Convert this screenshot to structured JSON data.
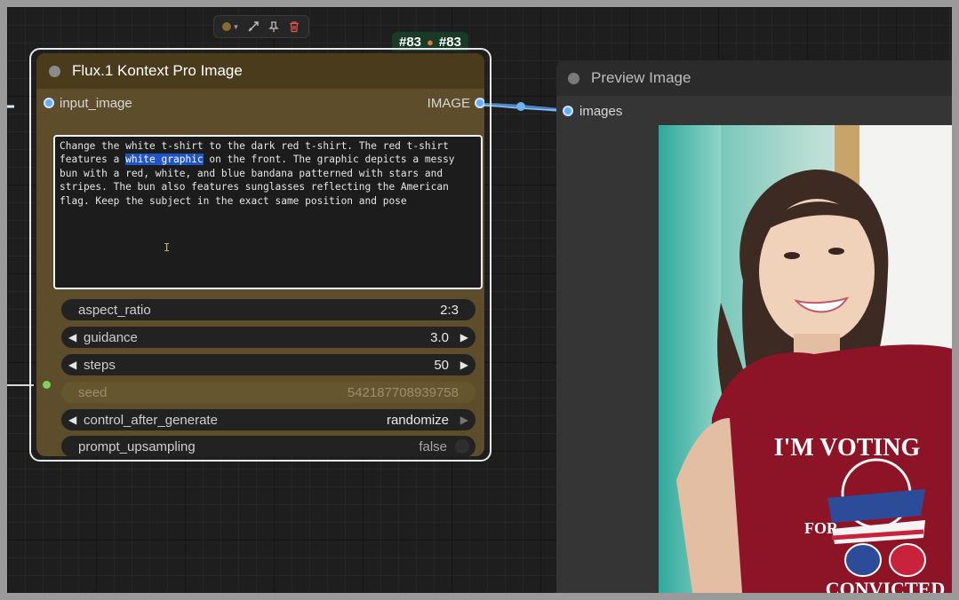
{
  "toolbar": {
    "icons": [
      "color-dot-icon",
      "chevron-down-icon",
      "bypass-icon",
      "pin-icon",
      "trash-icon"
    ],
    "accent_color": "#8a6a2e",
    "delete_color": "#e0564d"
  },
  "badge": {
    "id_text": "#83",
    "badge_text": "#83"
  },
  "node": {
    "title": "Flux.1 Kontext Pro Image",
    "input_label": "input_image",
    "output_label": "IMAGE",
    "prompt": {
      "before": "Change the white t-shirt to the dark red t-shirt. The red t-shirt\nfeatures a ",
      "highlight": "white graphic",
      "after": " on the front. The graphic depicts a messy\nbun with a red, white, and blue bandana patterned with stars and\nstripes. The bun also features sunglasses reflecting the American\nflag. Keep the subject in the exact same position and pose"
    },
    "widgets": {
      "aspect_ratio": {
        "label": "aspect_ratio",
        "value": "2:3"
      },
      "guidance": {
        "label": "guidance",
        "value": "3.0"
      },
      "steps": {
        "label": "steps",
        "value": "50"
      },
      "seed": {
        "label": "seed",
        "value": "542187708939758"
      },
      "control_after_generate": {
        "label": "control_after_generate",
        "value": "randomize"
      },
      "prompt_upsampling": {
        "label": "prompt_upsampling",
        "value": "false"
      }
    },
    "colors": {
      "body": "#5d4d2a",
      "header": "#4a3b1d"
    }
  },
  "preview": {
    "title": "Preview Image",
    "input_label": "images",
    "image_shirt_text": [
      "I'M VOTING",
      "FOR",
      "CONVICTED"
    ]
  }
}
